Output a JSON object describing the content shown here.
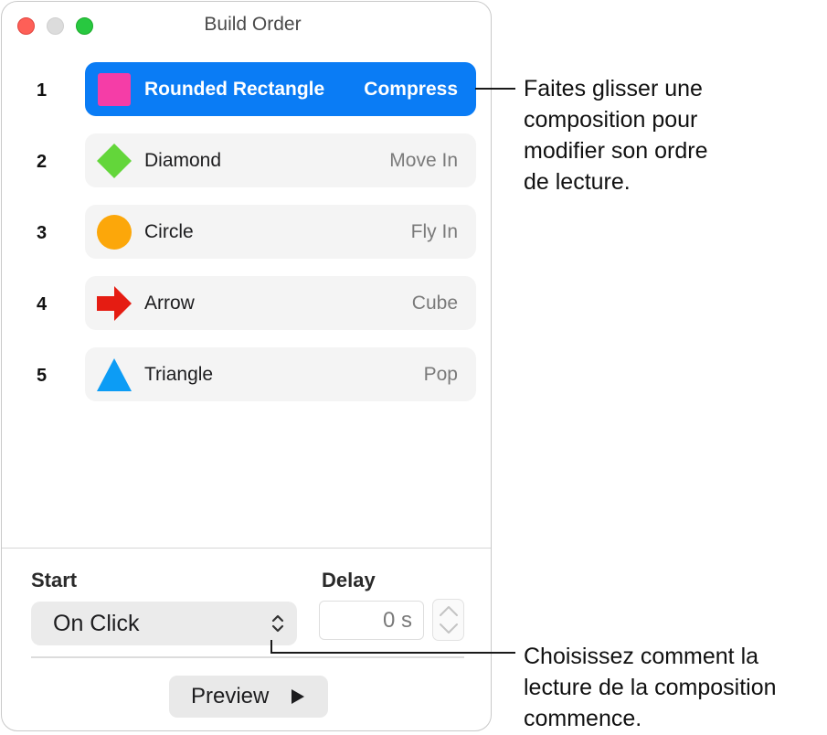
{
  "window": {
    "title": "Build Order"
  },
  "builds": [
    {
      "num": "1",
      "name": "Rounded Rectangle",
      "effect": "Compress",
      "icon": "pink-square-icon",
      "color": "#f53da7",
      "selected": true
    },
    {
      "num": "2",
      "name": "Diamond",
      "effect": "Move In",
      "icon": "green-diamond-icon",
      "color": "#63d63a",
      "selected": false
    },
    {
      "num": "3",
      "name": "Circle",
      "effect": "Fly In",
      "icon": "orange-circle-icon",
      "color": "#fca70a",
      "selected": false
    },
    {
      "num": "4",
      "name": "Arrow",
      "effect": "Cube",
      "icon": "red-arrow-icon",
      "color": "#e51c12",
      "selected": false
    },
    {
      "num": "5",
      "name": "Triangle",
      "effect": "Pop",
      "icon": "blue-triangle-icon",
      "color": "#0c9cf5",
      "selected": false
    }
  ],
  "start": {
    "label": "Start",
    "value": "On Click"
  },
  "delay": {
    "label": "Delay",
    "value": "0 s"
  },
  "preview": {
    "label": "Preview"
  },
  "callouts": {
    "top": [
      "Faites glisser une",
      "composition pour",
      "modifier son ordre",
      "de lecture."
    ],
    "bottom": [
      "Choisissez comment la",
      "lecture de la composition",
      "commence."
    ]
  },
  "colors": {
    "accent": "#0a7cf5"
  }
}
